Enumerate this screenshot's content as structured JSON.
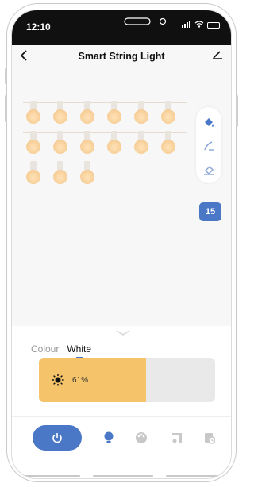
{
  "status_bar": {
    "time": "12:10"
  },
  "header": {
    "title": "Smart String Light",
    "back_icon": "chevron-left-icon",
    "edit_icon": "pencil-icon"
  },
  "bulbs": {
    "rows": [
      6,
      6,
      3
    ],
    "color": "#f6cd95"
  },
  "toolbar": {
    "tools": [
      "paint-bucket-icon",
      "brush-icon",
      "eraser-icon"
    ],
    "badge": "15",
    "accent": "#4a78c7"
  },
  "panel": {
    "tabs": [
      {
        "label": "Colour",
        "active": false
      },
      {
        "label": "White",
        "active": true
      }
    ],
    "brightness": {
      "text": "61%",
      "value": 0.61,
      "fill_color": "#f5c46a"
    }
  },
  "bottom_nav": {
    "items": [
      "power-icon",
      "bulb-icon",
      "palette-icon",
      "music-icon",
      "schedule-icon"
    ]
  }
}
